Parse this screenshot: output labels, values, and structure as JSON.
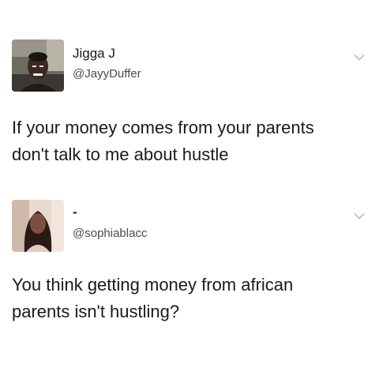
{
  "tweets": [
    {
      "display_name": "Jigga J",
      "handle": "@JayyDuffer",
      "text_line1": "If your money comes from your parents",
      "text_line2": "don't talk to me about hustle",
      "avatar": "avatar-photo-man",
      "menu_icon": "chevron-down-icon"
    },
    {
      "display_name": "-",
      "handle": "@sophiablacc",
      "text_line1": "You think getting money from african",
      "text_line2": "parents isn't hustling?",
      "avatar": "avatar-photo-woman",
      "menu_icon": "chevron-down-icon"
    }
  ],
  "colors": {
    "text": "#1a1a1a",
    "handle": "#4a4a4a",
    "chevron": "#b8bcc0",
    "background": "#ffffff"
  }
}
